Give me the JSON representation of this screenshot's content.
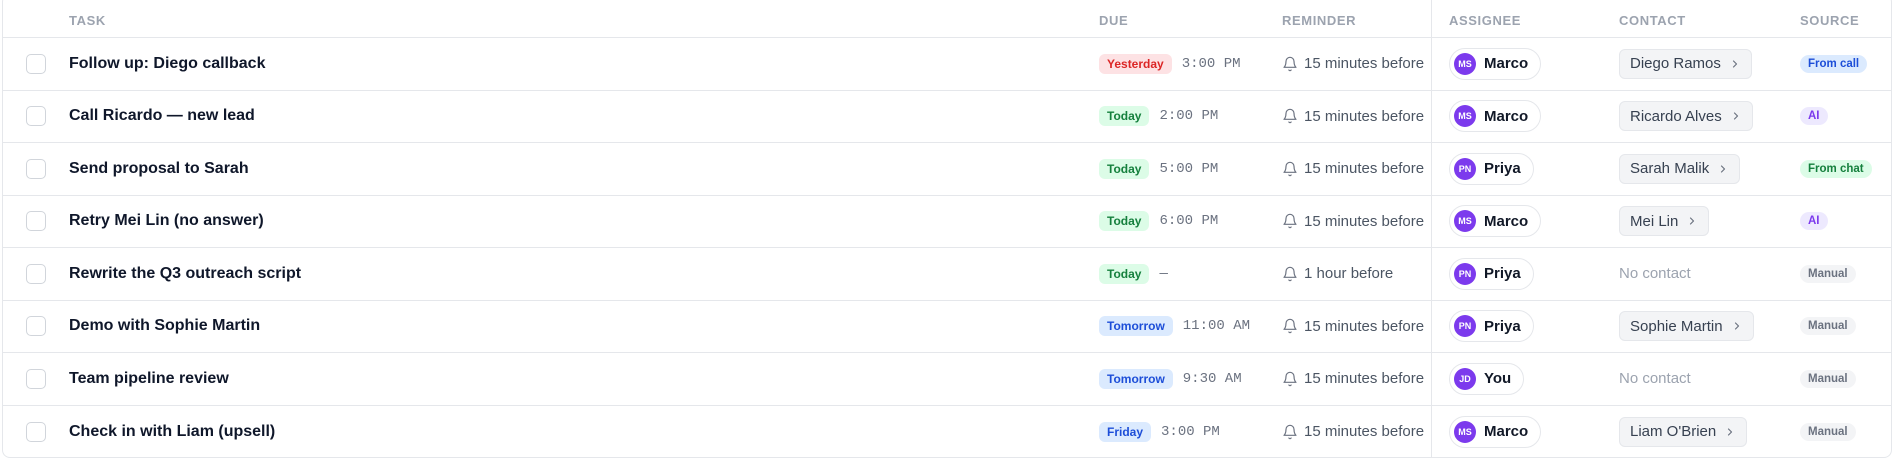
{
  "headers": {
    "task": "TASK",
    "due": "DUE",
    "reminder": "REMINDER",
    "assignee": "ASSIGNEE",
    "contact": "CONTACT",
    "source": "SOURCE"
  },
  "rows": [
    {
      "title": "Follow up: Diego callback",
      "due_label": "Yesterday",
      "due_kind": "yesterday",
      "due_time": "3:00 PM",
      "reminder": "15 minutes before",
      "assignee_initials": "MS",
      "assignee_name": "Marco",
      "contact": "Diego Ramos",
      "has_contact": true,
      "source": "From call",
      "source_kind": "call"
    },
    {
      "title": "Call Ricardo — new lead",
      "due_label": "Today",
      "due_kind": "today",
      "due_time": "2:00 PM",
      "reminder": "15 minutes before",
      "assignee_initials": "MS",
      "assignee_name": "Marco",
      "contact": "Ricardo Alves",
      "has_contact": true,
      "source": "AI",
      "source_kind": "ai"
    },
    {
      "title": "Send proposal to Sarah",
      "due_label": "Today",
      "due_kind": "today",
      "due_time": "5:00 PM",
      "reminder": "15 minutes before",
      "assignee_initials": "PN",
      "assignee_name": "Priya",
      "contact": "Sarah Malik",
      "has_contact": true,
      "source": "From chat",
      "source_kind": "chat"
    },
    {
      "title": "Retry Mei Lin (no answer)",
      "due_label": "Today",
      "due_kind": "today",
      "due_time": "6:00 PM",
      "reminder": "15 minutes before",
      "assignee_initials": "MS",
      "assignee_name": "Marco",
      "contact": "Mei Lin",
      "has_contact": true,
      "source": "AI",
      "source_kind": "ai"
    },
    {
      "title": "Rewrite the Q3 outreach script",
      "due_label": "Today",
      "due_kind": "today",
      "due_time": "—",
      "reminder": "1 hour before",
      "assignee_initials": "PN",
      "assignee_name": "Priya",
      "contact": "No contact",
      "has_contact": false,
      "source": "Manual",
      "source_kind": "manual"
    },
    {
      "title": "Demo with Sophie Martin",
      "due_label": "Tomorrow",
      "due_kind": "tomorrow",
      "due_time": "11:00 AM",
      "reminder": "15 minutes before",
      "assignee_initials": "PN",
      "assignee_name": "Priya",
      "contact": "Sophie Martin",
      "has_contact": true,
      "source": "Manual",
      "source_kind": "manual"
    },
    {
      "title": "Team pipeline review",
      "due_label": "Tomorrow",
      "due_kind": "tomorrow",
      "due_time": "9:30 AM",
      "reminder": "15 minutes before",
      "assignee_initials": "JD",
      "assignee_name": "You",
      "contact": "No contact",
      "has_contact": false,
      "source": "Manual",
      "source_kind": "manual"
    },
    {
      "title": "Check in with Liam (upsell)",
      "due_label": "Friday",
      "due_kind": "friday",
      "due_time": "3:00 PM",
      "reminder": "15 minutes before",
      "assignee_initials": "MS",
      "assignee_name": "Marco",
      "contact": "Liam O'Brien",
      "has_contact": true,
      "source": "Manual",
      "source_kind": "manual"
    }
  ],
  "icons": {
    "reminder": "bell-icon",
    "contact_open": "chevron-right-icon"
  },
  "colors": {
    "avatar": "#7c3aed",
    "yesterday": "#dc2626",
    "today": "#15803d",
    "tomorrow": "#1d4ed8"
  }
}
